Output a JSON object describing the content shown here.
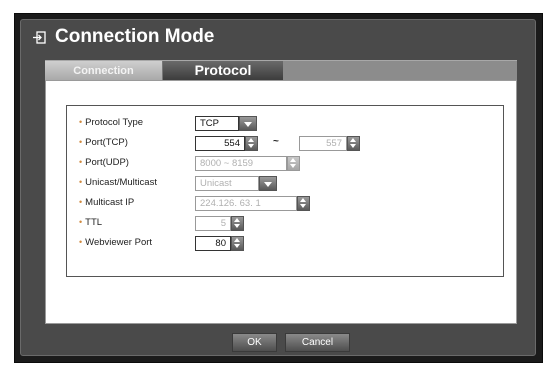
{
  "window": {
    "title": "Connection Mode",
    "title_icon": "enter-icon"
  },
  "tabs": [
    {
      "label": "Connection",
      "active": false
    },
    {
      "label": "Protocol",
      "active": true
    }
  ],
  "form": {
    "protocol_type": {
      "label": "Protocol Type",
      "value": "TCP"
    },
    "port_tcp": {
      "label": "Port(TCP)",
      "start": "554",
      "separator": "~",
      "end": "557"
    },
    "port_udp": {
      "label": "Port(UDP)",
      "value": "8000 ~ 8159"
    },
    "unicast_multicast": {
      "label": "Unicast/Multicast",
      "value": "Unicast"
    },
    "multicast_ip": {
      "label": "Multicast IP",
      "value": "224.126. 63. 1"
    },
    "ttl": {
      "label": "TTL",
      "value": "5"
    },
    "webviewer_port": {
      "label": "Webviewer Port",
      "value": "80"
    }
  },
  "buttons": {
    "ok": "OK",
    "cancel": "Cancel"
  },
  "colors": {
    "bullet": "#d08a40",
    "window_bg": "#4a4a4a",
    "active_tab": "#3a3a3a"
  }
}
